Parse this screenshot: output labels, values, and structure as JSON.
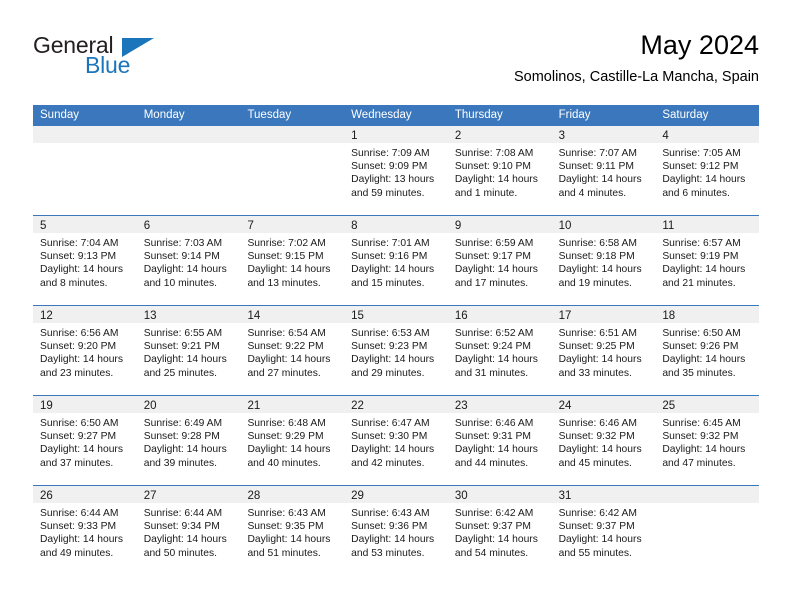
{
  "brand": {
    "name_top": "General",
    "name_bottom": "Blue",
    "color_dark": "#231f20",
    "color_blue": "#1b75bb"
  },
  "header": {
    "title": "May 2024",
    "subtitle": "Somolinos, Castille-La Mancha, Spain"
  },
  "theme": {
    "header_blue": "#3b77bc",
    "day_band_gray": "#f0f0f0",
    "text": "#1a1a1a"
  },
  "weekdays": [
    "Sunday",
    "Monday",
    "Tuesday",
    "Wednesday",
    "Thursday",
    "Friday",
    "Saturday"
  ],
  "weeks": [
    [
      {
        "day": "",
        "sunrise": "",
        "sunset": "",
        "daylight_line1": "",
        "daylight_line2": ""
      },
      {
        "day": "",
        "sunrise": "",
        "sunset": "",
        "daylight_line1": "",
        "daylight_line2": ""
      },
      {
        "day": "",
        "sunrise": "",
        "sunset": "",
        "daylight_line1": "",
        "daylight_line2": ""
      },
      {
        "day": "1",
        "sunrise": "Sunrise: 7:09 AM",
        "sunset": "Sunset: 9:09 PM",
        "daylight_line1": "Daylight: 13 hours",
        "daylight_line2": "and 59 minutes."
      },
      {
        "day": "2",
        "sunrise": "Sunrise: 7:08 AM",
        "sunset": "Sunset: 9:10 PM",
        "daylight_line1": "Daylight: 14 hours",
        "daylight_line2": "and 1 minute."
      },
      {
        "day": "3",
        "sunrise": "Sunrise: 7:07 AM",
        "sunset": "Sunset: 9:11 PM",
        "daylight_line1": "Daylight: 14 hours",
        "daylight_line2": "and 4 minutes."
      },
      {
        "day": "4",
        "sunrise": "Sunrise: 7:05 AM",
        "sunset": "Sunset: 9:12 PM",
        "daylight_line1": "Daylight: 14 hours",
        "daylight_line2": "and 6 minutes."
      }
    ],
    [
      {
        "day": "5",
        "sunrise": "Sunrise: 7:04 AM",
        "sunset": "Sunset: 9:13 PM",
        "daylight_line1": "Daylight: 14 hours",
        "daylight_line2": "and 8 minutes."
      },
      {
        "day": "6",
        "sunrise": "Sunrise: 7:03 AM",
        "sunset": "Sunset: 9:14 PM",
        "daylight_line1": "Daylight: 14 hours",
        "daylight_line2": "and 10 minutes."
      },
      {
        "day": "7",
        "sunrise": "Sunrise: 7:02 AM",
        "sunset": "Sunset: 9:15 PM",
        "daylight_line1": "Daylight: 14 hours",
        "daylight_line2": "and 13 minutes."
      },
      {
        "day": "8",
        "sunrise": "Sunrise: 7:01 AM",
        "sunset": "Sunset: 9:16 PM",
        "daylight_line1": "Daylight: 14 hours",
        "daylight_line2": "and 15 minutes."
      },
      {
        "day": "9",
        "sunrise": "Sunrise: 6:59 AM",
        "sunset": "Sunset: 9:17 PM",
        "daylight_line1": "Daylight: 14 hours",
        "daylight_line2": "and 17 minutes."
      },
      {
        "day": "10",
        "sunrise": "Sunrise: 6:58 AM",
        "sunset": "Sunset: 9:18 PM",
        "daylight_line1": "Daylight: 14 hours",
        "daylight_line2": "and 19 minutes."
      },
      {
        "day": "11",
        "sunrise": "Sunrise: 6:57 AM",
        "sunset": "Sunset: 9:19 PM",
        "daylight_line1": "Daylight: 14 hours",
        "daylight_line2": "and 21 minutes."
      }
    ],
    [
      {
        "day": "12",
        "sunrise": "Sunrise: 6:56 AM",
        "sunset": "Sunset: 9:20 PM",
        "daylight_line1": "Daylight: 14 hours",
        "daylight_line2": "and 23 minutes."
      },
      {
        "day": "13",
        "sunrise": "Sunrise: 6:55 AM",
        "sunset": "Sunset: 9:21 PM",
        "daylight_line1": "Daylight: 14 hours",
        "daylight_line2": "and 25 minutes."
      },
      {
        "day": "14",
        "sunrise": "Sunrise: 6:54 AM",
        "sunset": "Sunset: 9:22 PM",
        "daylight_line1": "Daylight: 14 hours",
        "daylight_line2": "and 27 minutes."
      },
      {
        "day": "15",
        "sunrise": "Sunrise: 6:53 AM",
        "sunset": "Sunset: 9:23 PM",
        "daylight_line1": "Daylight: 14 hours",
        "daylight_line2": "and 29 minutes."
      },
      {
        "day": "16",
        "sunrise": "Sunrise: 6:52 AM",
        "sunset": "Sunset: 9:24 PM",
        "daylight_line1": "Daylight: 14 hours",
        "daylight_line2": "and 31 minutes."
      },
      {
        "day": "17",
        "sunrise": "Sunrise: 6:51 AM",
        "sunset": "Sunset: 9:25 PM",
        "daylight_line1": "Daylight: 14 hours",
        "daylight_line2": "and 33 minutes."
      },
      {
        "day": "18",
        "sunrise": "Sunrise: 6:50 AM",
        "sunset": "Sunset: 9:26 PM",
        "daylight_line1": "Daylight: 14 hours",
        "daylight_line2": "and 35 minutes."
      }
    ],
    [
      {
        "day": "19",
        "sunrise": "Sunrise: 6:50 AM",
        "sunset": "Sunset: 9:27 PM",
        "daylight_line1": "Daylight: 14 hours",
        "daylight_line2": "and 37 minutes."
      },
      {
        "day": "20",
        "sunrise": "Sunrise: 6:49 AM",
        "sunset": "Sunset: 9:28 PM",
        "daylight_line1": "Daylight: 14 hours",
        "daylight_line2": "and 39 minutes."
      },
      {
        "day": "21",
        "sunrise": "Sunrise: 6:48 AM",
        "sunset": "Sunset: 9:29 PM",
        "daylight_line1": "Daylight: 14 hours",
        "daylight_line2": "and 40 minutes."
      },
      {
        "day": "22",
        "sunrise": "Sunrise: 6:47 AM",
        "sunset": "Sunset: 9:30 PM",
        "daylight_line1": "Daylight: 14 hours",
        "daylight_line2": "and 42 minutes."
      },
      {
        "day": "23",
        "sunrise": "Sunrise: 6:46 AM",
        "sunset": "Sunset: 9:31 PM",
        "daylight_line1": "Daylight: 14 hours",
        "daylight_line2": "and 44 minutes."
      },
      {
        "day": "24",
        "sunrise": "Sunrise: 6:46 AM",
        "sunset": "Sunset: 9:32 PM",
        "daylight_line1": "Daylight: 14 hours",
        "daylight_line2": "and 45 minutes."
      },
      {
        "day": "25",
        "sunrise": "Sunrise: 6:45 AM",
        "sunset": "Sunset: 9:32 PM",
        "daylight_line1": "Daylight: 14 hours",
        "daylight_line2": "and 47 minutes."
      }
    ],
    [
      {
        "day": "26",
        "sunrise": "Sunrise: 6:44 AM",
        "sunset": "Sunset: 9:33 PM",
        "daylight_line1": "Daylight: 14 hours",
        "daylight_line2": "and 49 minutes."
      },
      {
        "day": "27",
        "sunrise": "Sunrise: 6:44 AM",
        "sunset": "Sunset: 9:34 PM",
        "daylight_line1": "Daylight: 14 hours",
        "daylight_line2": "and 50 minutes."
      },
      {
        "day": "28",
        "sunrise": "Sunrise: 6:43 AM",
        "sunset": "Sunset: 9:35 PM",
        "daylight_line1": "Daylight: 14 hours",
        "daylight_line2": "and 51 minutes."
      },
      {
        "day": "29",
        "sunrise": "Sunrise: 6:43 AM",
        "sunset": "Sunset: 9:36 PM",
        "daylight_line1": "Daylight: 14 hours",
        "daylight_line2": "and 53 minutes."
      },
      {
        "day": "30",
        "sunrise": "Sunrise: 6:42 AM",
        "sunset": "Sunset: 9:37 PM",
        "daylight_line1": "Daylight: 14 hours",
        "daylight_line2": "and 54 minutes."
      },
      {
        "day": "31",
        "sunrise": "Sunrise: 6:42 AM",
        "sunset": "Sunset: 9:37 PM",
        "daylight_line1": "Daylight: 14 hours",
        "daylight_line2": "and 55 minutes."
      },
      {
        "day": "",
        "sunrise": "",
        "sunset": "",
        "daylight_line1": "",
        "daylight_line2": ""
      }
    ]
  ]
}
